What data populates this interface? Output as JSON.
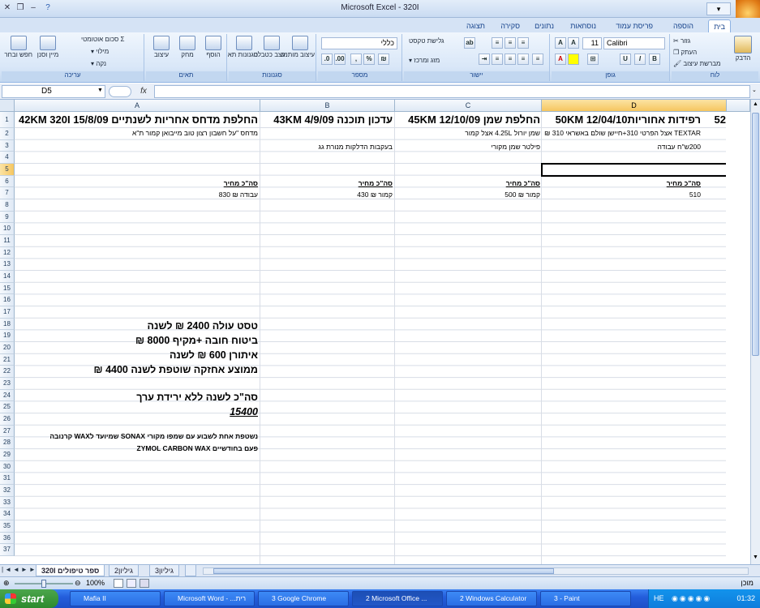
{
  "window": {
    "title": "Microsoft Excel - 320I"
  },
  "office_button": "office-logo",
  "ribbon_tabs": [
    "בית",
    "הוספה",
    "פריסת עמוד",
    "נוסחאות",
    "נתונים",
    "סקירה",
    "תצוגה"
  ],
  "ribbon": {
    "clipboard": {
      "paste": "הדבק",
      "cut": "גזור",
      "copy": "העתק",
      "format_painter": "מברשת עיצוב",
      "label": "לוח"
    },
    "font": {
      "name": "Calibri",
      "size": "11",
      "label": "גופן",
      "bold": "B",
      "italic": "I",
      "underline": "U"
    },
    "alignment": {
      "wrap": "גלישת טקסט",
      "merge": "מזג ומרכז",
      "label": "יישור"
    },
    "number": {
      "format": "כללי",
      "label": "מספר"
    },
    "styles": {
      "conditional": "עיצוב מותנה",
      "as_table": "עצב כטבלה",
      "cell_styles": "סגנונות תא",
      "label": "סגנונות"
    },
    "cells": {
      "insert": "הוסף",
      "delete": "מחק",
      "format": "עיצוב",
      "label": "תאים"
    },
    "editing": {
      "autosum": "סכום אוטומטי",
      "fill": "מילוי",
      "clear": "נקה",
      "sort": "מיין וסנן",
      "find": "חפש ובחר",
      "label": "עריכה"
    }
  },
  "formula_bar": {
    "name_box": "D5",
    "fx": "fx",
    "value": ""
  },
  "columns": [
    "D",
    "C",
    "B",
    "A"
  ],
  "selected_cell": "D5",
  "rows": [
    "1",
    "2",
    "3",
    "4",
    "5",
    "6",
    "7",
    "8",
    "9",
    "10",
    "11",
    "12",
    "13",
    "14",
    "15",
    "16",
    "17",
    "18",
    "19",
    "20",
    "21",
    "22",
    "23",
    "24",
    "25",
    "26",
    "27",
    "28",
    "29",
    "30",
    "31",
    "32",
    "33",
    "34",
    "35",
    "36",
    "37"
  ],
  "cells": {
    "E1": "52",
    "D1": "רפידות אחוריות12/04/10 50KM",
    "C1": "החלפת שמן 12/10/09 45KM",
    "B1": "עדכון תוכנה 4/9/09 43KM",
    "A1": "החלפת מדחס אחריות לשנתיים 15/8/09 42KM 320I",
    "D2": "TEXTAR אצל הפרטי 310+חיישן שולם באשראי 310 ₪",
    "C2": "שמן יורול 4.25L אצל קמור",
    "A2": "מדחס \"על חשבון רצון טוב מייבואן קמור ת\"א",
    "D3": "200ש\"ח עבודה",
    "C3": "פילטר שמן מקורי",
    "B3": "בעקבות הדלקות מנורת גג",
    "D6": "סה\"כ מחיר",
    "C6": "סה\"כ מחיר",
    "B6": "סה\"כ מחיר",
    "A6": "סה\"כ מחיר",
    "D7": "510",
    "C7": "קמור ₪ 500",
    "B7": "קמור ₪ 430",
    "A7": "עבודה ₪ 830",
    "A18": "טסט עולה 2400 ₪ לשנה",
    "A19": "ביטוח חובה +מקיף 8000 ₪",
    "A20": "איתורן 600 ₪ לשנה",
    "A21": "ממוצע אחזקה שוטפת לשנה 4400 ₪",
    "A23": "סה\"כ לשנה ללא ירידת ערך",
    "A24": "15400",
    "A26": "נשטפת אחת לשבוע עם שמפו מקורי SONAX שמיועד לWAX קרנובה",
    "A27": "פעם בחודשיים ZYMOL CARBON WAX"
  },
  "sheet_tabs": [
    "ספר טיפולים 320I",
    "גיליון2",
    "גיליון3"
  ],
  "active_sheet": "ספר טיפולים 320I",
  "zoom": "100%",
  "status": "מוכן",
  "taskbar": {
    "start": "start",
    "items": [
      "Mafia II",
      "Microsoft Word - ...רית",
      "3 Google Chrome",
      "2 Microsoft Office ...",
      "2 Windows Calculator",
      "3 - Paint"
    ],
    "active_item": "2 Microsoft Office ...",
    "lang": "HE",
    "clock": "01:32"
  }
}
